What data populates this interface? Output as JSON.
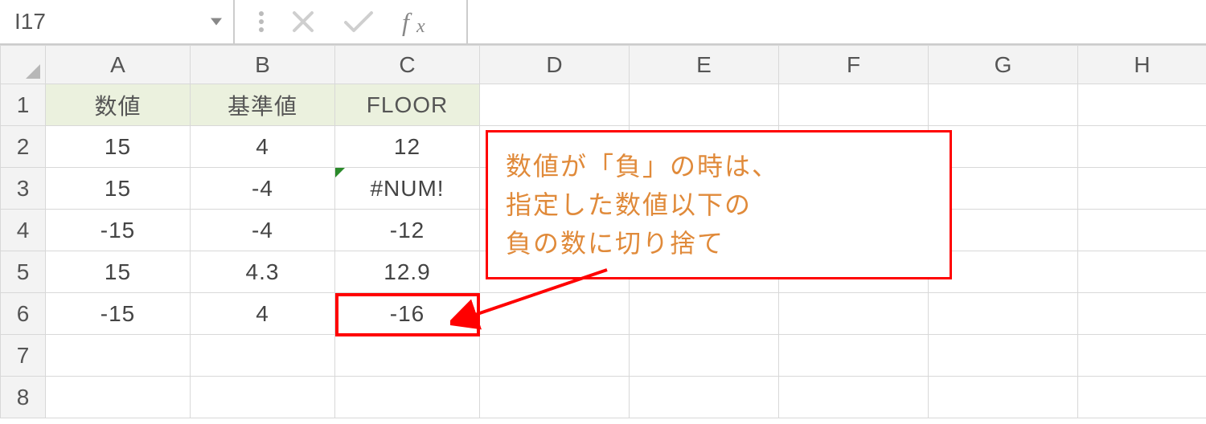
{
  "formula_bar": {
    "name_box": "I17",
    "formula_input": ""
  },
  "columns": [
    "A",
    "B",
    "C",
    "D",
    "E",
    "F",
    "G",
    "H"
  ],
  "row_numbers": [
    "1",
    "2",
    "3",
    "4",
    "5",
    "6",
    "7",
    "8"
  ],
  "table": {
    "headers": {
      "A": "数値",
      "B": "基準値",
      "C": "FLOOR"
    },
    "rows": [
      {
        "A": "15",
        "B": "4",
        "C": "12"
      },
      {
        "A": "15",
        "B": "-4",
        "C": "#NUM!"
      },
      {
        "A": "-15",
        "B": "-4",
        "C": "-12"
      },
      {
        "A": "15",
        "B": "4.3",
        "C": "12.9"
      },
      {
        "A": "-15",
        "B": "4",
        "C": "-16"
      }
    ]
  },
  "callout": {
    "line1": "数値が「負」の時は、",
    "line2": "指定した数値以下の",
    "line3": "負の数に切り捨て"
  },
  "icons": {
    "dropdown": "chevron-down-icon",
    "cancel": "x-icon",
    "confirm": "check-icon",
    "fx": "fx-icon"
  },
  "chart_data": {
    "type": "table",
    "title": "FLOOR",
    "columns": [
      "数値",
      "基準値",
      "FLOOR"
    ],
    "rows": [
      [
        15,
        4,
        12
      ],
      [
        15,
        -4,
        "#NUM!"
      ],
      [
        -15,
        -4,
        -12
      ],
      [
        15,
        4.3,
        12.9
      ],
      [
        -15,
        4,
        -16
      ]
    ]
  }
}
